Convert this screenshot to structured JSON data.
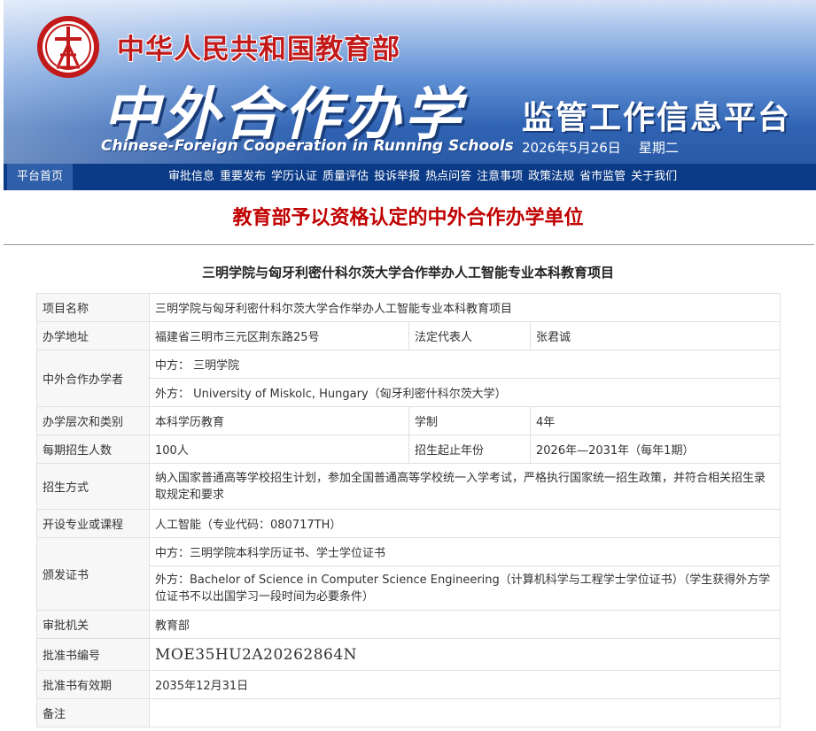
{
  "banner": {
    "ministry": "中华人民共和国教育部",
    "title": "中外合作办学",
    "subtitle_en": "Chinese-Foreign Cooperation in Running Schools",
    "platform": "监管工作信息平台",
    "date": "2026年5月26日",
    "weekday": "星期二",
    "brand_color": "#2f63b3",
    "accent_color": "#c21a1a"
  },
  "nav": {
    "home": "平台首页",
    "items": [
      "审批信息",
      "重要发布",
      "学历认证",
      "质量评估",
      "投诉举报",
      "热点问答",
      "注意事项",
      "政策法规",
      "省市监管",
      "关于我们"
    ]
  },
  "page": {
    "title": "教育部予以资格认定的中外合作办学单位",
    "project_title": "三明学院与匈牙利密什科尔茨大学合作举办人工智能专业本科教育项目"
  },
  "table": {
    "project_name": {
      "label": "项目名称",
      "value": "三明学院与匈牙利密什科尔茨大学合作举办人工智能专业本科教育项目"
    },
    "address": {
      "label": "办学地址",
      "value": "福建省三明市三元区荆东路25号"
    },
    "legal_rep": {
      "label": "法定代表人",
      "value": "张君诚"
    },
    "partners": {
      "label": "中外合作办学者",
      "cn": "中方：  三明学院",
      "foreign": "外方：  University of Miskolc, Hungary（匈牙利密什科尔茨大学）"
    },
    "level": {
      "label": "办学层次和类别",
      "value": "本科学历教育"
    },
    "duration": {
      "label": "学制",
      "value": "4年"
    },
    "enrollment": {
      "label": "每期招生人数",
      "value": "100人"
    },
    "enroll_years": {
      "label": "招生起止年份",
      "value": "2026年—2031年（每年1期）"
    },
    "admission": {
      "label": "招生方式",
      "value": "纳入国家普通高等学校招生计划，参加全国普通高等学校统一入学考试，严格执行国家统一招生政策，并符合相关招生录取规定和要求"
    },
    "major": {
      "label": "开设专业或课程",
      "value": "人工智能（专业代码：080717TH）"
    },
    "certificates": {
      "label": "颁发证书",
      "cn": "中方：三明学院本科学历证书、学士学位证书",
      "foreign": "外方：Bachelor of Science in Computer Science Engineering（计算机科学与工程学士学位证书）（学生获得外方学位证书不以出国学习一段时间为必要条件）"
    },
    "authority": {
      "label": "审批机关",
      "value": "教育部"
    },
    "approval_no": {
      "label": "批准书编号",
      "value": "MOE35HU2A20262864N"
    },
    "validity": {
      "label": "批准书有效期",
      "value": "2035年12月31日"
    },
    "remarks": {
      "label": "备注",
      "value": ""
    }
  }
}
